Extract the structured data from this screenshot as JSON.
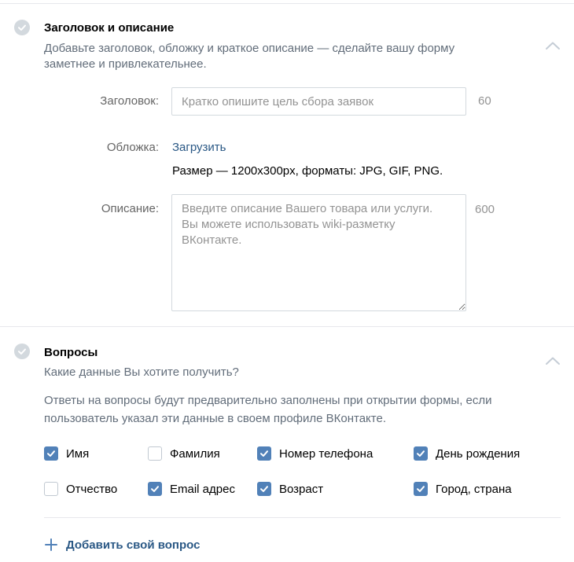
{
  "colors": {
    "accent": "#5181b8",
    "link": "#2a5885",
    "muted": "#939393",
    "divider": "#e7e8ec"
  },
  "section_title": {
    "icon": "check-circle-icon",
    "title": "Заголовок и описание",
    "description_line1": "Добавьте заголовок, обложку и краткое описание — сделайте вашу форму",
    "description_line2": "заметнее и привлекательнее.",
    "collapse_icon": "chevron-up-icon",
    "fields": {
      "title_label": "Заголовок:",
      "title_placeholder": "Кратко опишите цель сбора заявок",
      "title_value": "",
      "title_counter": "60",
      "cover_label": "Обложка:",
      "cover_link": "Загрузить",
      "cover_hint": "Размер — 1200x300px, форматы: JPG, GIF, PNG.",
      "description_label": "Описание:",
      "description_placeholder": "Введите описание Вашего товара или услуги.\nВы можете использовать wiki-разметку\nВКонтакте.",
      "description_value": "",
      "description_counter": "600"
    }
  },
  "section_questions": {
    "icon": "check-circle-icon",
    "title": "Вопросы",
    "subtitle": "Какие данные Вы хотите получить?",
    "note_line1": "Ответы на вопросы будут предварительно заполнены при открытии формы, если",
    "note_line2": "пользователь указал эти данные в своем профиле ВКонтакте.",
    "collapse_icon": "chevron-up-icon",
    "options": [
      {
        "label": "Имя",
        "checked": true
      },
      {
        "label": "Фамилия",
        "checked": false
      },
      {
        "label": "Номер телефона",
        "checked": true
      },
      {
        "label": "День рождения",
        "checked": true
      },
      {
        "label": "Отчество",
        "checked": false
      },
      {
        "label": "Email адрес",
        "checked": true
      },
      {
        "label": "Возраст",
        "checked": true
      },
      {
        "label": "Город, страна",
        "checked": true
      }
    ],
    "add_question": {
      "icon": "plus-icon",
      "label": "Добавить свой вопрос"
    }
  }
}
